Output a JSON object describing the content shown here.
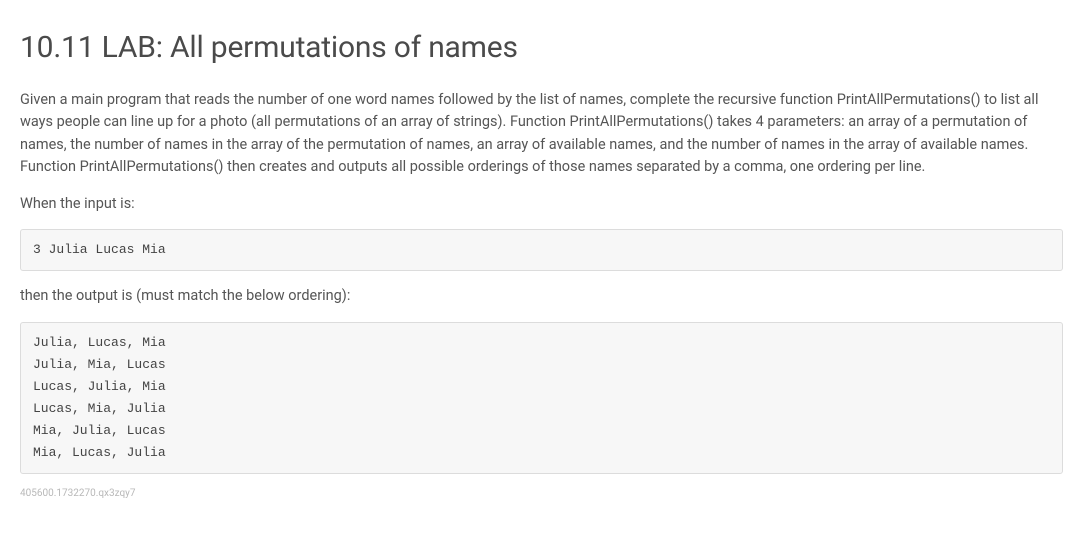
{
  "title": "10.11 LAB: All permutations of names",
  "description": "Given a main program that reads the number of one word names followed by the list of names, complete the recursive function PrintAllPermutations() to list all ways people can line up for a photo (all permutations of an array of strings). Function PrintAllPermutations() takes 4 parameters: an array of a permutation of names, the number of names in the array of the permutation of names, an array of available names, and the number of names in the array of available names. Function PrintAllPermutations() then creates and outputs all possible orderings of those names separated by a comma, one ordering per line.",
  "input_label": "When the input is:",
  "input_example": "3 Julia Lucas Mia",
  "output_label": "then the output is (must match the below ordering):",
  "output_example": "Julia, Lucas, Mia\nJulia, Mia, Lucas\nLucas, Julia, Mia\nLucas, Mia, Julia\nMia, Julia, Lucas\nMia, Lucas, Julia",
  "footer_id": "405600.1732270.qx3zqy7"
}
